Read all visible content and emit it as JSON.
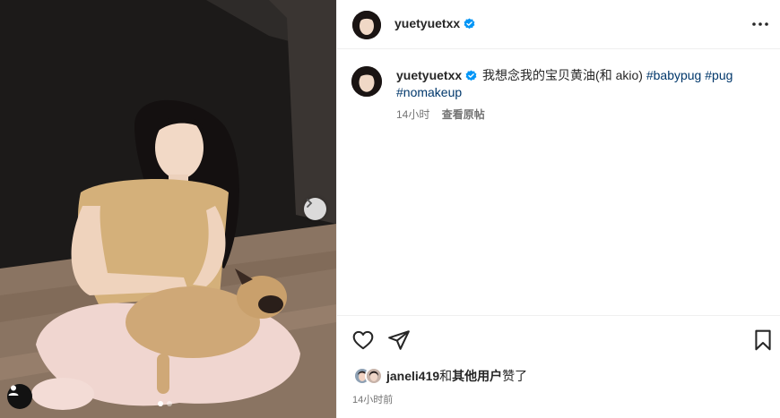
{
  "post": {
    "username": "yuetyuetxx",
    "verified": true,
    "caption_text": "我想念我的宝贝黄油(和 akio)",
    "hashtags": [
      "#babypug",
      "#pug",
      "#nomakeup"
    ],
    "caption_time": "14小时",
    "see_original_label": "查看原帖",
    "liked_by_user": "janeli419",
    "liked_by_joiner": "和",
    "liked_by_others": "其他用户",
    "liked_suffix": "赞了",
    "post_time": "14小时前",
    "carousel": {
      "total": 2,
      "current": 1
    }
  },
  "icons": {
    "header_more": "more-horizontal-icon",
    "verified": "verified-badge-icon",
    "like": "heart-icon",
    "share": "send-paper-plane-icon",
    "save": "bookmark-icon",
    "next": "chevron-right-icon",
    "tags": "user-tag-icon"
  },
  "colors": {
    "verified_blue": "#0095f6",
    "hashtag": "#00376b",
    "secondary_text": "#737373",
    "divider": "#efefef"
  }
}
